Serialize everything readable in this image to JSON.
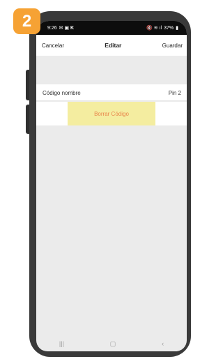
{
  "step_badge": "2",
  "status_bar": {
    "time": "9:26",
    "battery": "37%"
  },
  "navbar": {
    "cancel_label": "Cancelar",
    "title": "Editar",
    "save_label": "Guardar"
  },
  "code_row": {
    "label": "Código nombre",
    "value": "Pin 2"
  },
  "delete_button_label": "Borrar Código",
  "colors": {
    "accent": "#f6a234",
    "delete_bg": "#f4eda0",
    "delete_text": "#e8834a"
  }
}
